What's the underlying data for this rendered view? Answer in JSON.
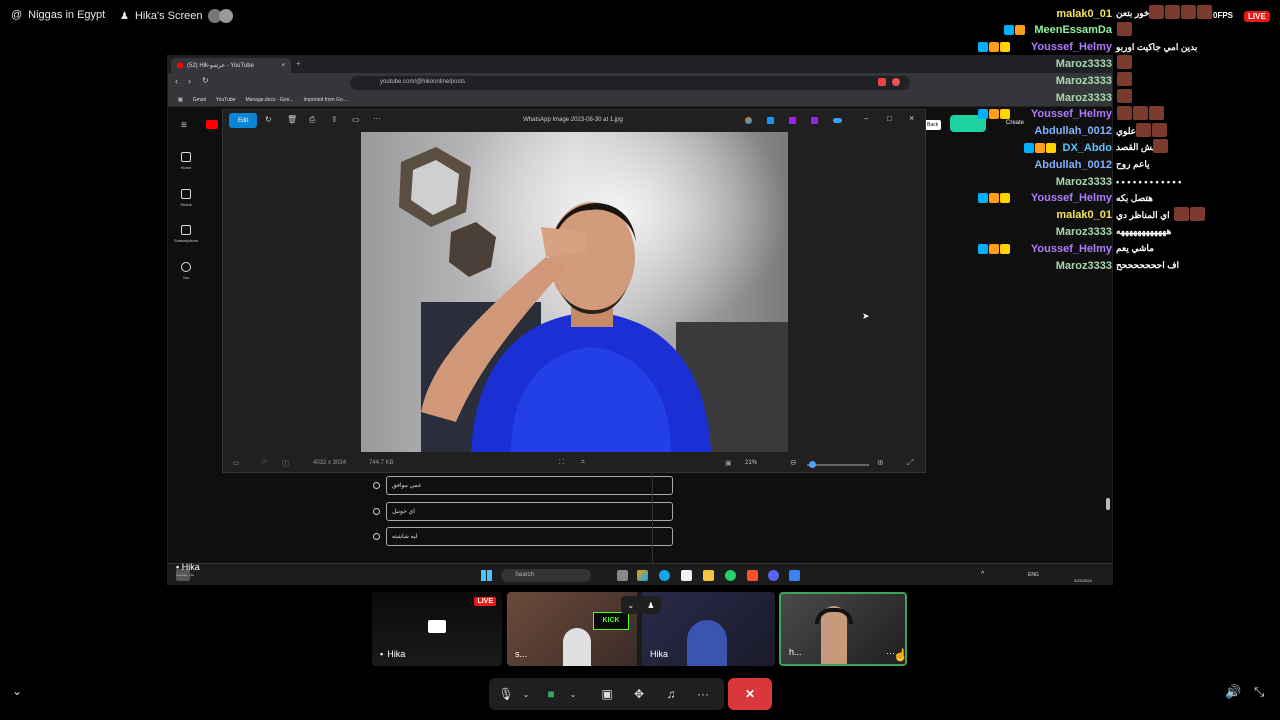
{
  "topbar": {
    "server_name": "Niggas in Egypt",
    "screen_title": "Hika's Screen"
  },
  "browser": {
    "tab_title": "(52) Hik-عرشو - YouTube",
    "url": "youtube.com/@hikoonline/posts",
    "bookmarks": [
      "Gmail",
      "YouTube",
      "Manage.docx - Goo...",
      "Imported from Go..."
    ],
    "create_label": "Create",
    "feedback_label": "Back"
  },
  "youtube_sidebar": {
    "items": [
      "Home",
      "Shorts",
      "Subscriptions",
      "You"
    ]
  },
  "viewer": {
    "edit_label": "Edit",
    "file_title": "WhatsApp Image 2023-08-30 at 1.jpg",
    "dimensions": "4032 x 3024",
    "file_size": "744.7 KB",
    "zoom": "21%"
  },
  "poll": {
    "options": [
      "عمي موافق",
      "اي خونيل",
      "ليه شاشته"
    ]
  },
  "taskbar": {
    "search_placeholder": "Search",
    "lang": "ENG",
    "date": "3/24/2024"
  },
  "stream": {
    "fps_label": "0FPS",
    "live_label": "LIVE"
  },
  "chat": [
    {
      "user": "malak0_01",
      "msg": "",
      "color": "#f7e45c",
      "badges": 0,
      "emotes": 0,
      "extra": "خور بتعن",
      "extra_emotes": 4
    },
    {
      "user": "MeenEssamDa",
      "msg": "",
      "color": "#8ef0a0",
      "badges": 2,
      "emotes": 1
    },
    {
      "user": "Youssef_Helmy",
      "msg": "بدين امي جاكيت اوربو",
      "color": "#b07cff",
      "badges": 3,
      "emotes": 0
    },
    {
      "user": "Maroz3333",
      "msg": "",
      "color": "#a8d8b0",
      "badges": 0,
      "emotes": 1
    },
    {
      "user": "Maroz3333",
      "msg": "",
      "color": "#a8d8b0",
      "badges": 0,
      "emotes": 1
    },
    {
      "user": "Maroz3333",
      "msg": "",
      "color": "#a8d8b0",
      "badges": 0,
      "emotes": 1
    },
    {
      "user": "Youssef_Helmy",
      "msg": "",
      "color": "#b07cff",
      "badges": 3,
      "emotes": 3
    },
    {
      "user": "Abdullah_0012",
      "msg": "علوي",
      "color": "#7fb3ff",
      "badges": 0,
      "emotes": 2
    },
    {
      "user": "DX_Abdo",
      "msg": "مش القصد",
      "color": "#56c6ff",
      "badges": 3,
      "emotes": 1
    },
    {
      "user": "Abdullah_0012",
      "msg": "ياعم روح",
      "color": "#7fb3ff",
      "badges": 0,
      "emotes": 0
    },
    {
      "user": "Maroz3333",
      "msg": "• • • • • • • • • • • •",
      "color": "#a8d8b0",
      "badges": 0,
      "emotes": 0
    },
    {
      "user": "Youssef_Helmy",
      "msg": "هتصل بكه",
      "color": "#b07cff",
      "badges": 3,
      "emotes": 0
    },
    {
      "user": "malak0_01",
      "msg": "اي المناظر دي",
      "color": "#f7e45c",
      "badges": 0,
      "emotes": 2
    },
    {
      "user": "Maroz3333",
      "msg": "ههههههههههههه",
      "color": "#a8d8b0",
      "badges": 0,
      "emotes": 0
    },
    {
      "user": "Youssef_Helmy",
      "msg": "ماشي يعم",
      "color": "#b07cff",
      "badges": 3,
      "emotes": 0
    },
    {
      "user": "Maroz3333",
      "msg": "اف احححححححح",
      "color": "#a8d8b0",
      "badges": 0,
      "emotes": 0
    }
  ],
  "tiles": {
    "screen_share_name": "Hika",
    "screen_share_live": "LIVE",
    "streamer_1_name": "s...",
    "streamer_2_name": "Hika",
    "webcam_name": "h..."
  },
  "sharing_label": "Hika",
  "sharing_sub": "بثك بشاشة"
}
